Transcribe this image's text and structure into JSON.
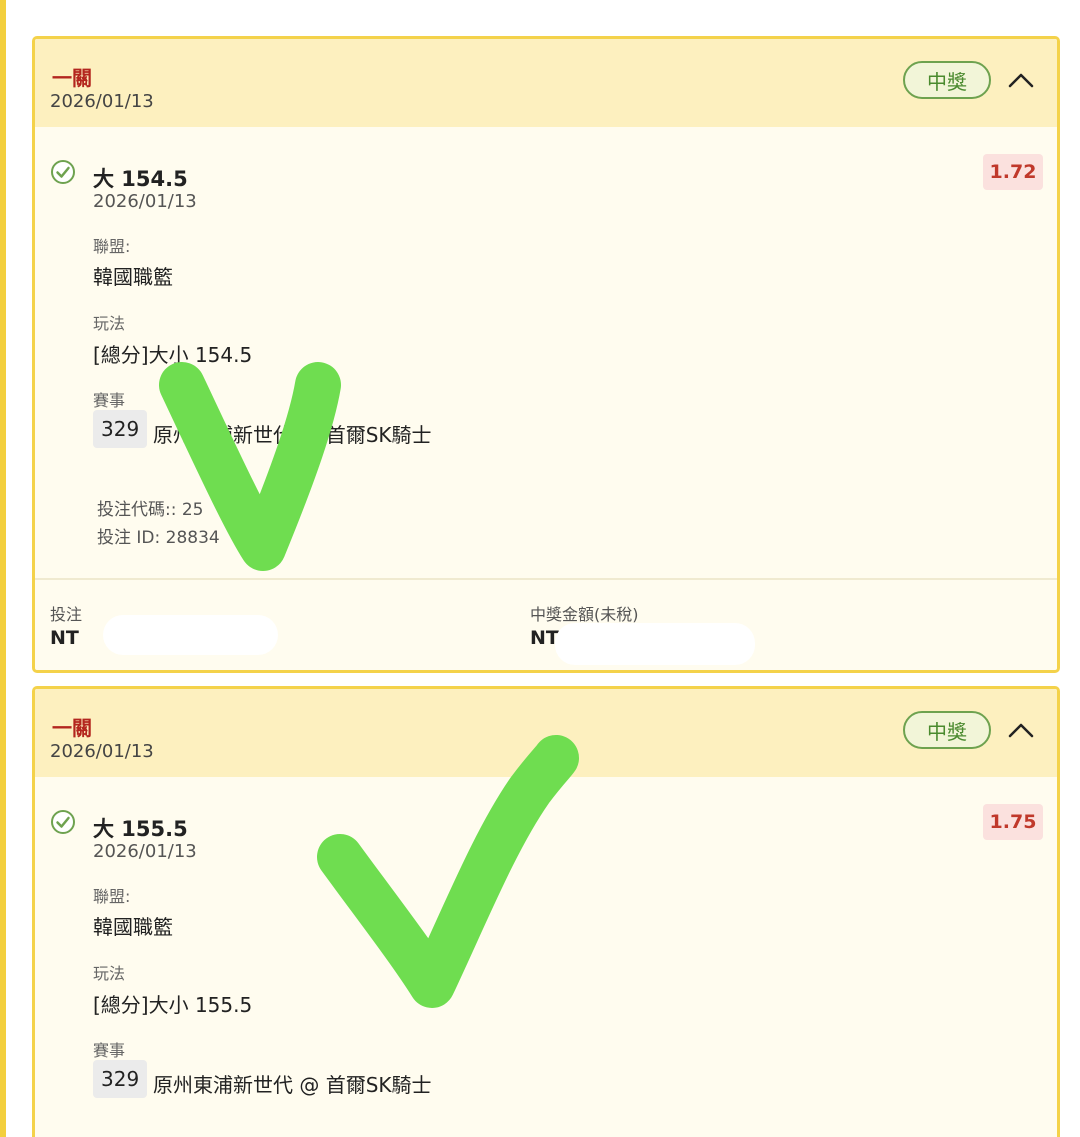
{
  "cards": [
    {
      "header": {
        "title": "一關",
        "date": "2026/01/13",
        "status": "中獎"
      },
      "selection": {
        "title": "大 154.5",
        "date": "2026/01/13",
        "odds": "1.72"
      },
      "league": {
        "label": "聯盟:",
        "value": "韓國職籃"
      },
      "play": {
        "label": "玩法",
        "value": "[總分]大小 154.5"
      },
      "match": {
        "label": "賽事",
        "number": "329",
        "name": "原州東浦新世代 @ 首爾SK騎士"
      },
      "bet_code": "投注代碼:: 25",
      "bet_id": "投注 ID: 28834",
      "footer": {
        "stake_label": "投注",
        "stake_value": "NT",
        "payout_label": "中獎金額(未稅)",
        "payout_value": "NT"
      }
    },
    {
      "header": {
        "title": "一關",
        "date": "2026/01/13",
        "status": "中獎"
      },
      "selection": {
        "title": "大 155.5",
        "date": "2026/01/13",
        "odds": "1.75"
      },
      "league": {
        "label": "聯盟:",
        "value": "韓國職籃"
      },
      "play": {
        "label": "玩法",
        "value": "[總分]大小 155.5"
      },
      "match": {
        "label": "賽事",
        "number": "329",
        "name": "原州東浦新世代 @ 首爾SK騎士"
      }
    }
  ],
  "colors": {
    "card_border": "#f4d24a",
    "header_bg": "#fdf0bf",
    "body_bg": "#fffcef",
    "title_red": "#b3261e",
    "win_green": "#4a8a2e",
    "odds_red": "#c0392b",
    "overlay_check": "#6fdd50"
  }
}
